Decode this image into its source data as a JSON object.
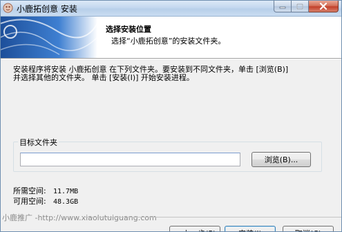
{
  "window": {
    "title": "小鹿拓创意 安装"
  },
  "header": {
    "title": "选择安装位置",
    "subtitle": "选择“小鹿拓创意”的安装文件夹。"
  },
  "body": {
    "description_line1": "安装程序将安装 小鹿拓创意 在下列文件夹。要安装到不同文件夹，单击 [浏览(B)]",
    "description_line2": "并选择其他的文件夹。 单击 [安装(I)] 开始安装进程。",
    "folder_group_label": "目标文件夹",
    "folder_value": "",
    "browse_label": "浏览(B)...",
    "space_required_label": "所需空间:",
    "space_required_value": "11.7MB",
    "space_available_label": "可用空间:",
    "space_available_value": "48.3GB"
  },
  "footer": {
    "brand_text": "小鹿推广 -http://www.xiaolutuiguang.com",
    "back_label": "< 上一步(P)",
    "install_label": "安装(I)",
    "cancel_label": "取消(C)"
  },
  "colors": {
    "title_bar": "#c4d8ef",
    "close_button": "#c2402a",
    "header_background": "#ffffff",
    "window_background": "#f0f0f0"
  },
  "icons": [
    "app-icon",
    "minimize-icon",
    "maximize-icon",
    "close-icon",
    "installer-header-art"
  ]
}
